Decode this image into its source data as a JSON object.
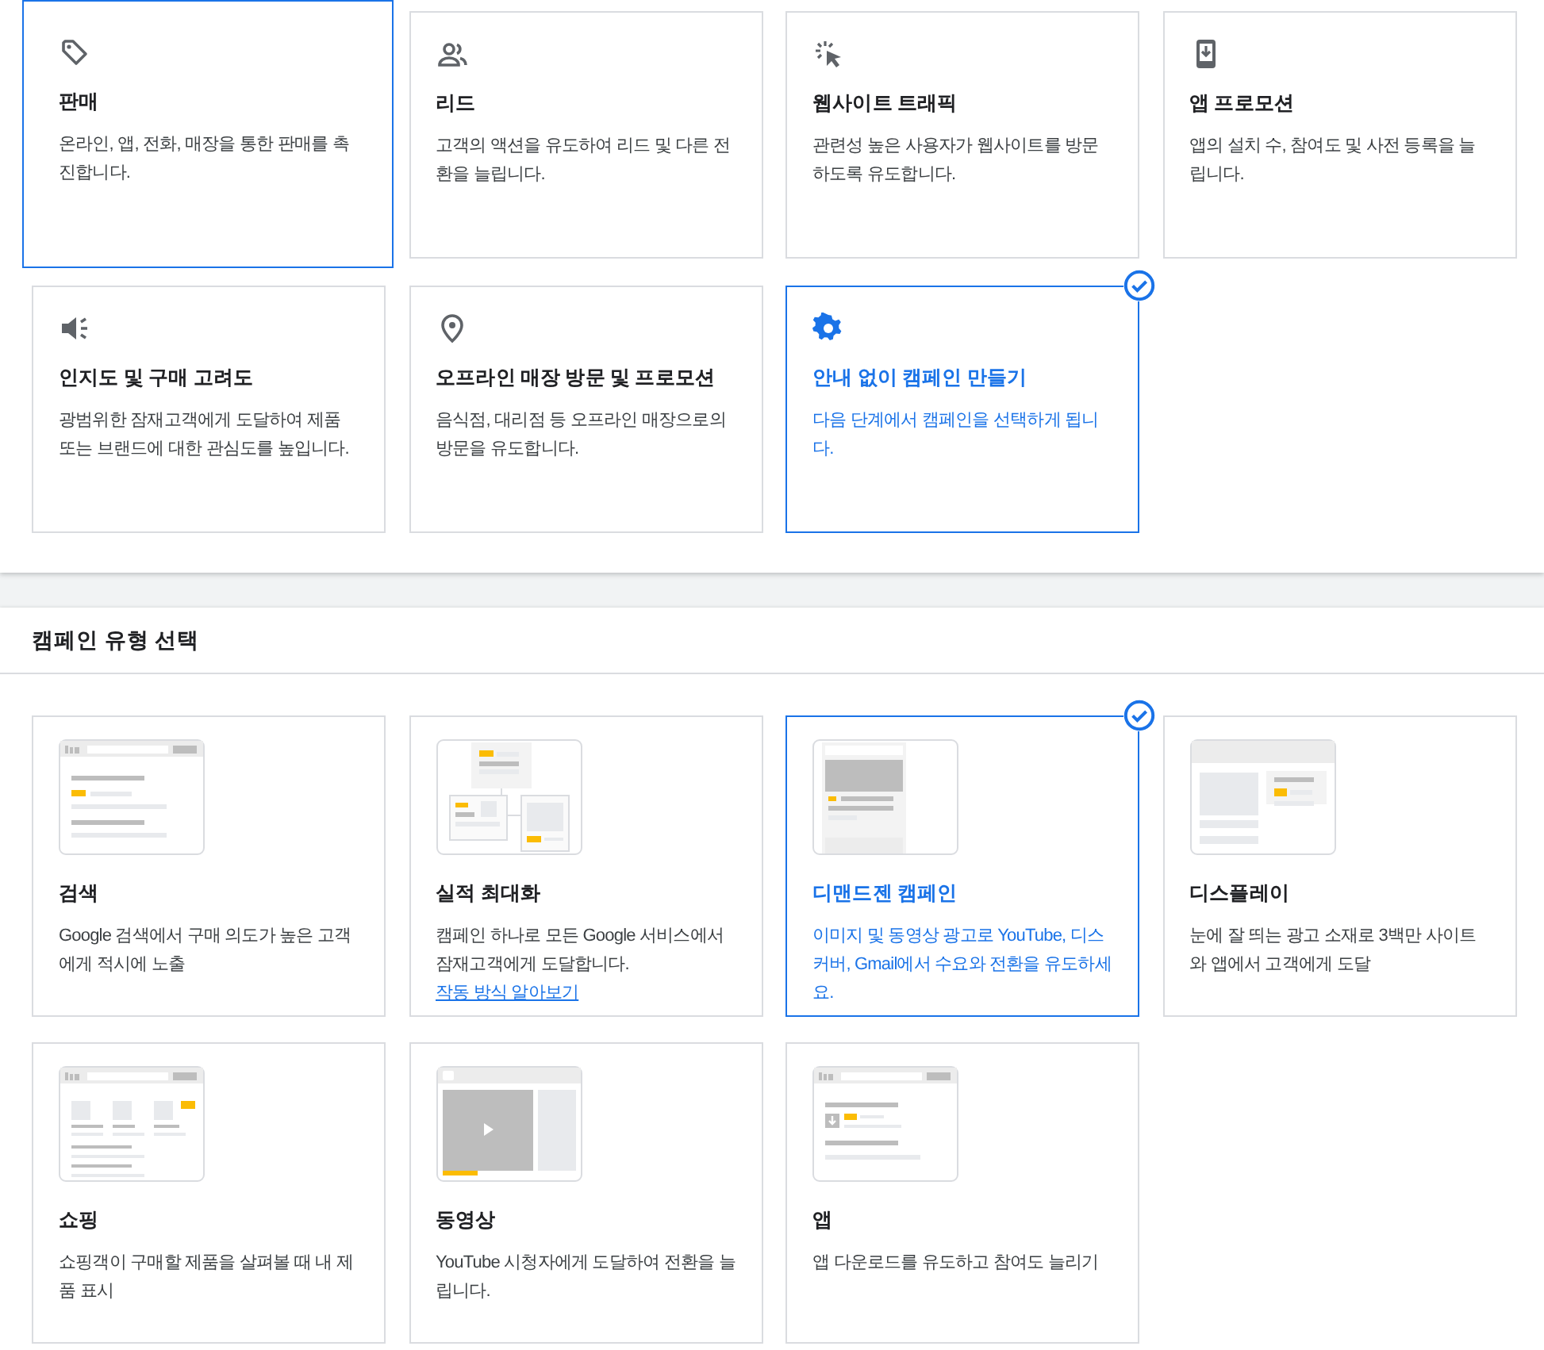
{
  "goals": [
    {
      "title": "판매",
      "description": "온라인, 앱, 전화, 매장을 통한 판매를 촉진합니다.",
      "selected": false,
      "focused": true
    },
    {
      "title": "리드",
      "description": "고객의 액션을 유도하여 리드 및 다른 전환을 늘립니다.",
      "selected": false,
      "focused": false
    },
    {
      "title": "웹사이트 트래픽",
      "description": "관련성 높은 사용자가 웹사이트를 방문하도록 유도합니다.",
      "selected": false,
      "focused": false
    },
    {
      "title": "앱 프로모션",
      "description": "앱의 설치 수, 참여도 및 사전 등록을 늘립니다.",
      "selected": false,
      "focused": false
    },
    {
      "title": "인지도 및 구매 고려도",
      "description": "광범위한 잠재고객에게 도달하여 제품 또는 브랜드에 대한 관심도를 높입니다.",
      "selected": false,
      "focused": false
    },
    {
      "title": "오프라인 매장 방문 및 프로모션",
      "description": "음식점, 대리점 등 오프라인 매장으로의 방문을 유도합니다.",
      "selected": false,
      "focused": false
    },
    {
      "title": "안내 없이 캠페인 만들기",
      "description": "다음 단계에서 캠페인을 선택하게 됩니다.",
      "selected": true,
      "focused": false
    }
  ],
  "campaign_types": {
    "heading": "캠페인 유형 선택",
    "items": [
      {
        "kind": "search",
        "title": "검색",
        "description": "Google 검색에서 구매 의도가 높은 고객에게 적시에 노출",
        "selected": false
      },
      {
        "kind": "pmax",
        "title": "실적 최대화",
        "description": "캠페인 하나로 모든 Google 서비스에서 잠재고객에게 도달합니다.",
        "link": "작동 방식 알아보기",
        "selected": false
      },
      {
        "kind": "demandgen",
        "title": "디맨드젠 캠페인",
        "description": "이미지 및 동영상 광고로 YouTube, 디스커버, Gmail에서 수요와 전환을 유도하세요.",
        "selected": true
      },
      {
        "kind": "display",
        "title": "디스플레이",
        "description": "눈에 잘 띄는 광고 소재로 3백만 사이트와 앱에서 고객에게 도달",
        "selected": false
      },
      {
        "kind": "shopping",
        "title": "쇼핑",
        "description": "쇼핑객이 구매할 제품을 살펴볼 때 내 제품 표시",
        "selected": false
      },
      {
        "kind": "video",
        "title": "동영상",
        "description": "YouTube 시청자에게 도달하여 전환을 늘립니다.",
        "selected": false
      },
      {
        "kind": "app",
        "title": "앱",
        "description": "앱 다운로드를 유도하고 참여도 늘리기",
        "selected": false
      }
    ]
  }
}
